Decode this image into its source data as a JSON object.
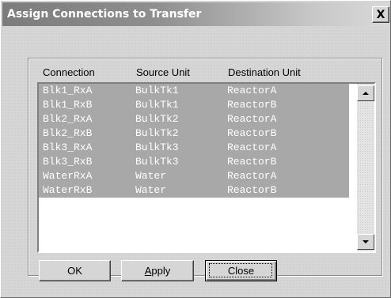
{
  "window": {
    "title": "Assign Connections to Transfer",
    "close_glyph": "X"
  },
  "list": {
    "columns": [
      "Connection",
      "Source Unit",
      "Destination Unit"
    ],
    "rows": [
      {
        "connection": "Blk1_RxA",
        "source": "BulkTk1",
        "destination": "ReactorA"
      },
      {
        "connection": "Blk1_RxB",
        "source": "BulkTk1",
        "destination": "ReactorB"
      },
      {
        "connection": "Blk2_RxA",
        "source": "BulkTk2",
        "destination": "ReactorA"
      },
      {
        "connection": "Blk2_RxB",
        "source": "BulkTk2",
        "destination": "ReactorB"
      },
      {
        "connection": "Blk3_RxA",
        "source": "BulkTk3",
        "destination": "ReactorA"
      },
      {
        "connection": "Blk3_RxB",
        "source": "BulkTk3",
        "destination": "ReactorB"
      },
      {
        "connection": "WaterRxA",
        "source": "Water",
        "destination": "ReactorA"
      },
      {
        "connection": "WaterRxB",
        "source": "Water",
        "destination": "ReactorB"
      }
    ],
    "selected_rows": "all"
  },
  "buttons": {
    "ok": "OK",
    "apply_first": "A",
    "apply_rest": "pply",
    "close": "Close"
  },
  "colors": {
    "titlebar_start": "#7c7c7c",
    "titlebar_end": "#d9d9d9",
    "selection": "#a8a8a8",
    "face": "#d6d6d6"
  }
}
